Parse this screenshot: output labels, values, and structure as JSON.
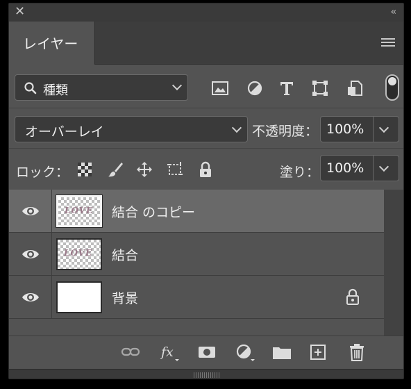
{
  "window": {
    "close_icon": "close-icon",
    "collapse_icon": "double-chevron-icon"
  },
  "tab": {
    "label": "レイヤー"
  },
  "filter": {
    "type_label": "種類",
    "icons": [
      "image-filter-icon",
      "adjustment-filter-icon",
      "type-filter-icon",
      "shape-filter-icon",
      "smart-object-filter-icon"
    ],
    "toggle": "on"
  },
  "blend": {
    "mode": "オーバーレイ",
    "opacity_label": "不透明度：",
    "opacity": "100%"
  },
  "lock": {
    "label": "ロック：",
    "fill_label": "塗り：",
    "fill": "100%"
  },
  "layers": [
    {
      "name": "結合 のコピー",
      "selected": true,
      "thumb": "checker",
      "visible": true
    },
    {
      "name": "結合",
      "selected": false,
      "thumb": "checker",
      "visible": true
    },
    {
      "name": "背景",
      "selected": false,
      "thumb": "white",
      "visible": true,
      "locked": true
    }
  ],
  "footer": {
    "icons": [
      "link-icon",
      "fx-icon",
      "mask-icon",
      "adjustment-icon",
      "folder-icon",
      "new-layer-icon",
      "trash-icon"
    ]
  },
  "colors": {
    "panel": "#535353",
    "selected_row": "#696969",
    "field": "#3a3a3a",
    "text": "#f0f0f0"
  }
}
